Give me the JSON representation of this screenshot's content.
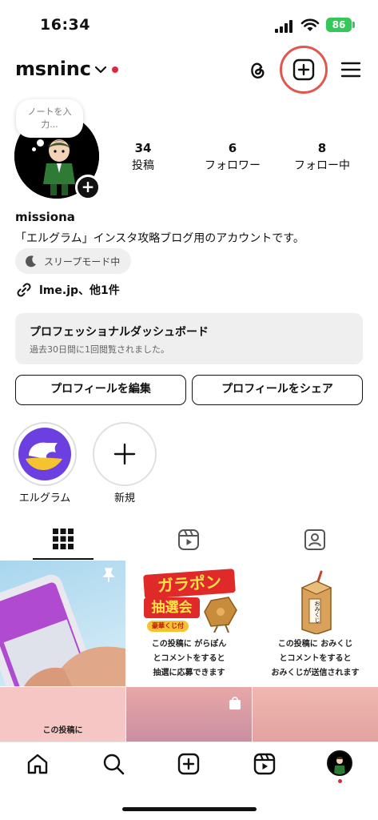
{
  "status_bar": {
    "time": "16:34",
    "battery": "86",
    "battery_color": "#34c759"
  },
  "header": {
    "username": "msninc",
    "dropdown_icon": "chevron-down-icon",
    "notification_dot_color": "#e0263f",
    "icons": [
      "threads-icon",
      "create-plus-icon",
      "menu-icon"
    ],
    "highlight_ring_color": "#e0574f"
  },
  "profile": {
    "note_placeholder": "ノートを入\n力...",
    "stats": [
      {
        "value": "34",
        "label": "投稿"
      },
      {
        "value": "6",
        "label": "フォロワー"
      },
      {
        "value": "8",
        "label": "フォロー中"
      }
    ],
    "display_name": "missiona",
    "bio": "「エルグラム」インスタ攻略ブログ用のアカウントです。",
    "sleep_mode": "スリープモード中",
    "link": "lme.jp、他1件"
  },
  "dashboard": {
    "title": "プロフェッショナルダッシュボード",
    "subtitle": "過去30日間に1回閲覧されました。"
  },
  "buttons": {
    "edit_profile": "プロフィールを編集",
    "share_profile": "プロフィールをシェア"
  },
  "highlights": [
    {
      "label": "エルグラム"
    },
    {
      "label": "新規"
    }
  ],
  "tabs": [
    "grid-icon",
    "reels-icon",
    "tagged-icon"
  ],
  "grid": {
    "post2": {
      "banner_line1": "ガラポン",
      "banner_line2": "抽選会",
      "badge": "豪華くじ付",
      "caption": [
        "この投稿に がらぽん",
        "とコメントをすると",
        "抽選に応募できます"
      ]
    },
    "post3": {
      "box_label": "おみくじ",
      "caption": [
        "この投稿に おみくじ",
        "とコメントをすると",
        "おみくじが送信されます"
      ]
    },
    "post4": {
      "caption": "この投稿に"
    }
  },
  "bottom_nav": [
    "home-icon",
    "search-icon",
    "create-icon",
    "reels-icon",
    "profile-avatar"
  ]
}
